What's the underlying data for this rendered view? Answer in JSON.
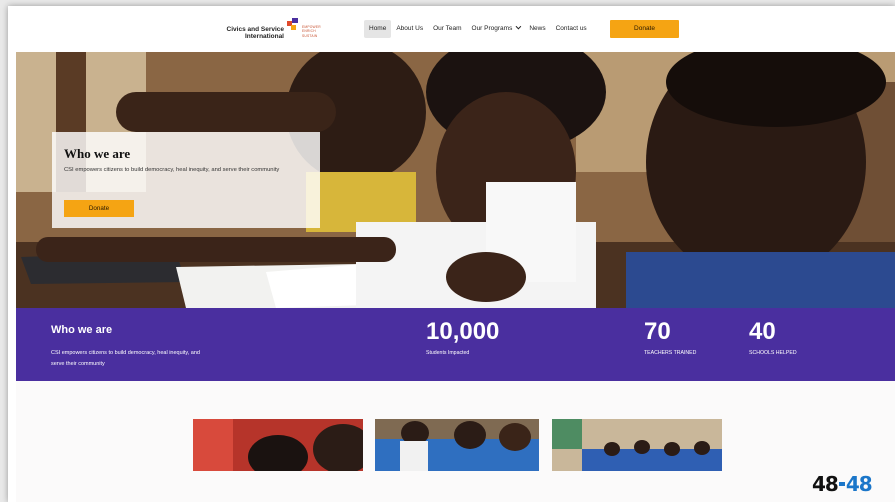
{
  "header": {
    "logo": {
      "name": "Civics and Service International",
      "tagline": "EMPOWER ENRICH SUSTAIN"
    },
    "nav": [
      {
        "label": "Home",
        "active": true
      },
      {
        "label": "About Us"
      },
      {
        "label": "Our Team"
      },
      {
        "label": "Our Programs",
        "dropdown": true
      },
      {
        "label": "News"
      },
      {
        "label": "Contact us"
      }
    ],
    "donate_label": "Donate"
  },
  "hero": {
    "title": "Who we are",
    "text": "CSI empowers citizens to build democracy, heal inequity, and serve their community",
    "donate_label": "Donate"
  },
  "stats": {
    "title": "Who we are",
    "text": "CSI empowers citizens to build democracy, heal inequity, and serve their community",
    "items": [
      {
        "number": "10,000",
        "label": "Students Impacted"
      },
      {
        "number": "70",
        "label": "TEACHERS TRAINED"
      },
      {
        "number": "40",
        "label": "SCHOOLS HELPED"
      }
    ]
  },
  "badge": {
    "left": "48",
    "right": "48"
  },
  "colors": {
    "accent": "#f5a413",
    "purple": "#4a2f9f"
  }
}
